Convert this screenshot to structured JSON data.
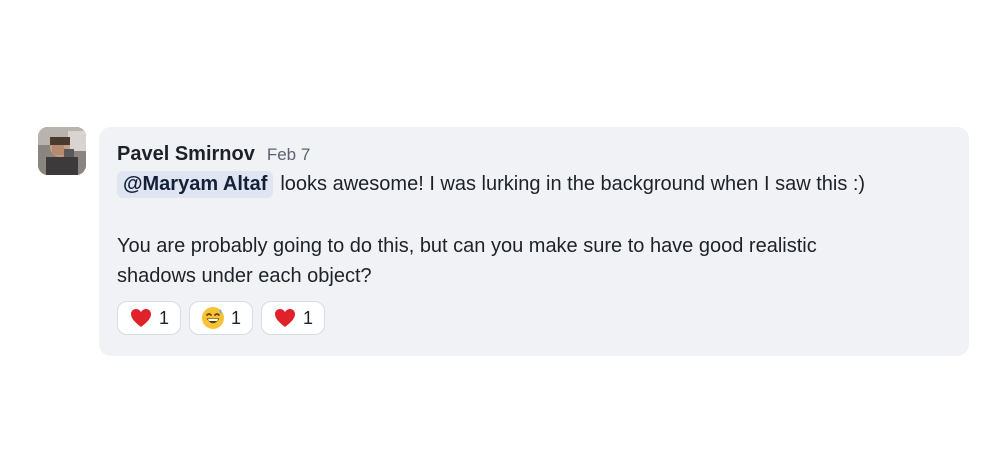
{
  "message": {
    "author": "Pavel Smirnov",
    "date": "Feb 7",
    "mention": "@Maryam Altaf",
    "line1_text": "looks awesome! I was lurking in the background when I saw this :)",
    "paragraph2_line1": "You are probably going to do this, but can you make sure to have good realistic",
    "paragraph2_line2": "shadows under each object?"
  },
  "reactions": [
    {
      "icon": "red-heart-icon",
      "count": "1"
    },
    {
      "icon": "grinning-sweat-face-icon",
      "count": "1"
    },
    {
      "icon": "red-heart-icon",
      "count": "1"
    }
  ],
  "colors": {
    "bubble_background": "#f1f2f6",
    "mention_background": "#dfe5f1",
    "heart": "#e0202a",
    "emoji_face": "#f7c234"
  }
}
